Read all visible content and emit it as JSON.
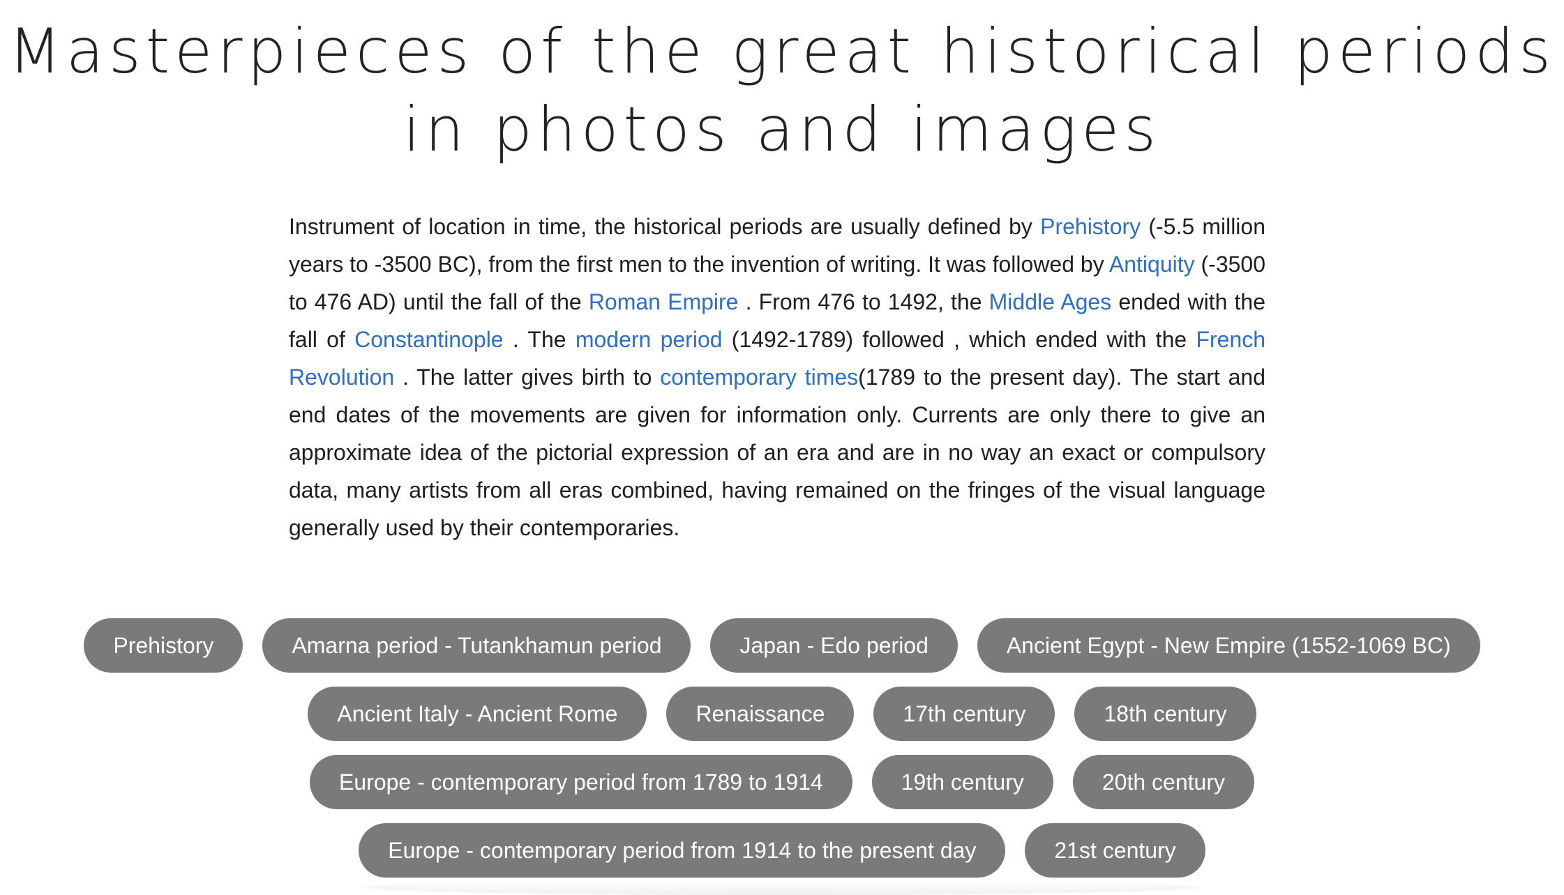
{
  "header": {
    "title_line1": "Masterpieces of the great historical periods",
    "title_line2": "in photos and images"
  },
  "intro": {
    "t1": "Instrument of location in time, the historical periods are usually defined by ",
    "l1": "Prehistory",
    "t2": " (-5.5 million years to -3500 BC), from the first men to the invention of writing. It was followed by ",
    "l2": "Antiquity",
    "t3": " (-3500 to 476 AD) until the fall of the ",
    "l3": "Roman Empire",
    "t4": " . From 476 to 1492, the ",
    "l4": "Middle Ages",
    "t5": " ended with the fall of ",
    "l5": "Constantinople",
    "t6": " . The ",
    "l6": "modern period",
    "t7": " (1492-1789) followed , which ended with the ",
    "l7": "French Revolution",
    "t8": " . The latter gives birth to ",
    "l8": "contemporary times",
    "t9": "(1789 to the present day). The start and end dates of the movements are given for information only. Currents are only there to give an approximate idea of the pictorial expression of an era and are in no way an exact or compulsory data, many artists from all eras combined, having remained on the fringes of the visual language generally used by their contemporaries.",
    "link_color": "#2f6fc2"
  },
  "tags": {
    "row1": [
      "Prehistory",
      "Amarna period - Tutankhamun period",
      "Japan - Edo period",
      "Ancient Egypt - New Empire (1552-1069 BC)"
    ],
    "row2": [
      "Ancient Italy - Ancient Rome",
      "Renaissance",
      "17th century",
      "18th century"
    ],
    "row3": [
      "Europe - contemporary period from 1789 to 1914",
      "19th century",
      "20th century"
    ],
    "row4": [
      "Europe - contemporary period from 1914 to the present day",
      "21st century"
    ],
    "background_color": "#7a7a7a",
    "text_color": "#ffffff"
  }
}
